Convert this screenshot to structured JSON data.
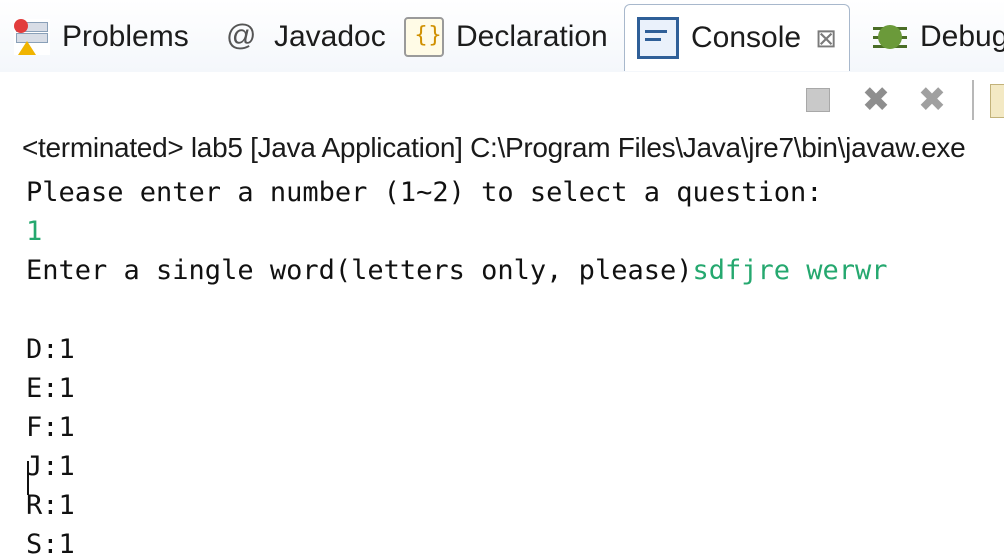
{
  "tabs": [
    {
      "label": "Problems",
      "icon": "problems-icon"
    },
    {
      "label": "Javadoc",
      "icon": "javadoc-icon"
    },
    {
      "label": "Declaration",
      "icon": "declaration-icon"
    },
    {
      "label": "Console",
      "icon": "console-icon",
      "active": true,
      "close_glyph": "⊠"
    },
    {
      "label": "Debug",
      "icon": "debug-icon"
    }
  ],
  "toolbar": {
    "terminate_icon": "terminate-icon",
    "remove_icon": "remove-launch-icon",
    "remove_all_icon": "remove-all-terminated-icon"
  },
  "status_line": "<terminated> lab5 [Java Application] C:\\Program Files\\Java\\jre7\\bin\\javaw.exe",
  "console": {
    "prompt_question": "Please enter a number (1~2) to select a question:",
    "input_number": "1",
    "prompt_word": "Enter a single word(letters only, please)",
    "input_word": "sdfjre werwr",
    "counts": [
      "D:1",
      "E:1",
      "F:1",
      "J:1",
      "R:1",
      "S:1"
    ]
  },
  "colors": {
    "user_input": "#25a86f",
    "output_text": "#111111",
    "console_tab_border": "#a8b8cc"
  }
}
